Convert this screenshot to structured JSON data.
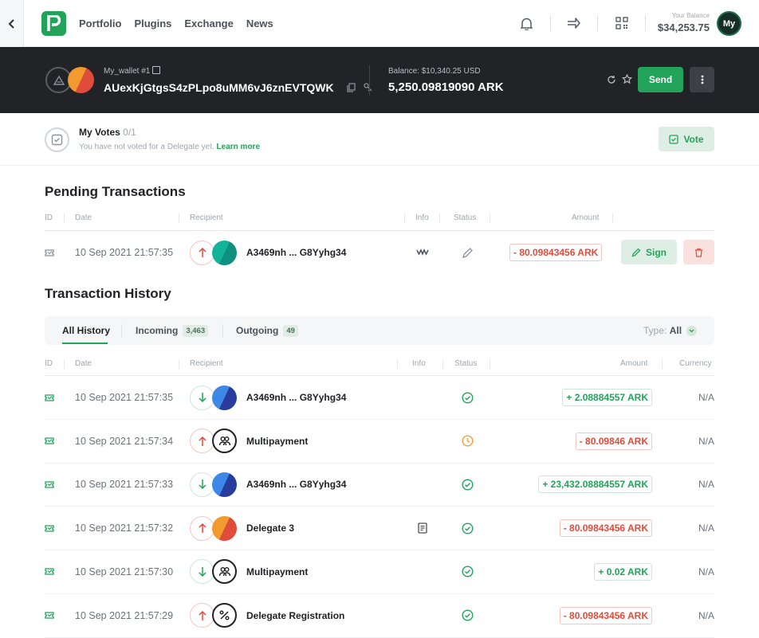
{
  "colors": {
    "accent": "#23a35a",
    "danger": "#e04c3b",
    "dark": "#222326",
    "pending": "#f0a040"
  },
  "nav": {
    "items": [
      "Portfolio",
      "Plugins",
      "Exchange",
      "News"
    ]
  },
  "header": {
    "balance_label": "Your Balance",
    "balance_value": "$34,253.75",
    "avatar_text": "My"
  },
  "wallet": {
    "name": "My_wallet #1",
    "address": "AUexKjGtgsS4zPLpo8uMM6vJ6znEVTQWK",
    "balance_label": "Balance: $10,340.25 USD",
    "balance_value": "5,250.09819090 ARK",
    "send_label": "Send"
  },
  "votes": {
    "title": "My Votes",
    "count": "0/1",
    "subtitle": "You have not voted for a Delegate yet.",
    "link": "Learn more",
    "vote_label": "Vote"
  },
  "pending": {
    "title": "Pending Transactions",
    "columns": [
      "ID",
      "Date",
      "Recipient",
      "Info",
      "Status",
      "Amount"
    ],
    "row": {
      "date": "10 Sep 2021 21:57:35",
      "recipient": "A3469nh ... G8Yyhg34",
      "amount": "- 80.09843456 ARK",
      "sign_label": "Sign",
      "direction": "out",
      "status": "edit-icon",
      "info": "multisignature-icon"
    }
  },
  "history": {
    "title": "Transaction History",
    "tabs": [
      {
        "label": "All History",
        "count": ""
      },
      {
        "label": "Incoming",
        "count": "3,463"
      },
      {
        "label": "Outgoing",
        "count": "49"
      }
    ],
    "type_label": "Type:",
    "type_value": "All",
    "columns": [
      "ID",
      "Date",
      "Recipient",
      "Info",
      "Status",
      "Amount",
      "Currency"
    ],
    "rows": [
      {
        "date": "10 Sep 2021 21:57:35",
        "recipient": "A3469nh ... G8Yyhg34",
        "amount": "+ 2.08884557 ARK",
        "currency": "N/A",
        "direction": "in",
        "avatar": "blue",
        "status": "confirmed",
        "info": ""
      },
      {
        "date": "10 Sep 2021 21:57:34",
        "recipient": "Multipayment",
        "amount": "- 80.09846 ARK",
        "currency": "N/A",
        "direction": "out",
        "avatar": "multipayment",
        "status": "pending",
        "info": ""
      },
      {
        "date": "10 Sep 2021 21:57:33",
        "recipient": "A3469nh ... G8Yyhg34",
        "amount": "+ 23,432.08884557 ARK",
        "currency": "N/A",
        "direction": "in",
        "avatar": "blue",
        "status": "confirmed",
        "info": ""
      },
      {
        "date": "10 Sep 2021 21:57:32",
        "recipient": "Delegate 3",
        "amount": "- 80.09843456 ARK",
        "currency": "N/A",
        "direction": "out",
        "avatar": "orange",
        "status": "confirmed",
        "info": "memo"
      },
      {
        "date": "10 Sep 2021 21:57:30",
        "recipient": "Multipayment",
        "amount": "+ 0.02 ARK",
        "currency": "N/A",
        "direction": "in",
        "avatar": "multipayment",
        "status": "confirmed",
        "info": ""
      },
      {
        "date": "10 Sep 2021 21:57:29",
        "recipient": "Delegate Registration",
        "amount": "- 80.09843456 ARK",
        "currency": "N/A",
        "direction": "out",
        "avatar": "delegate",
        "status": "confirmed",
        "info": ""
      }
    ]
  }
}
